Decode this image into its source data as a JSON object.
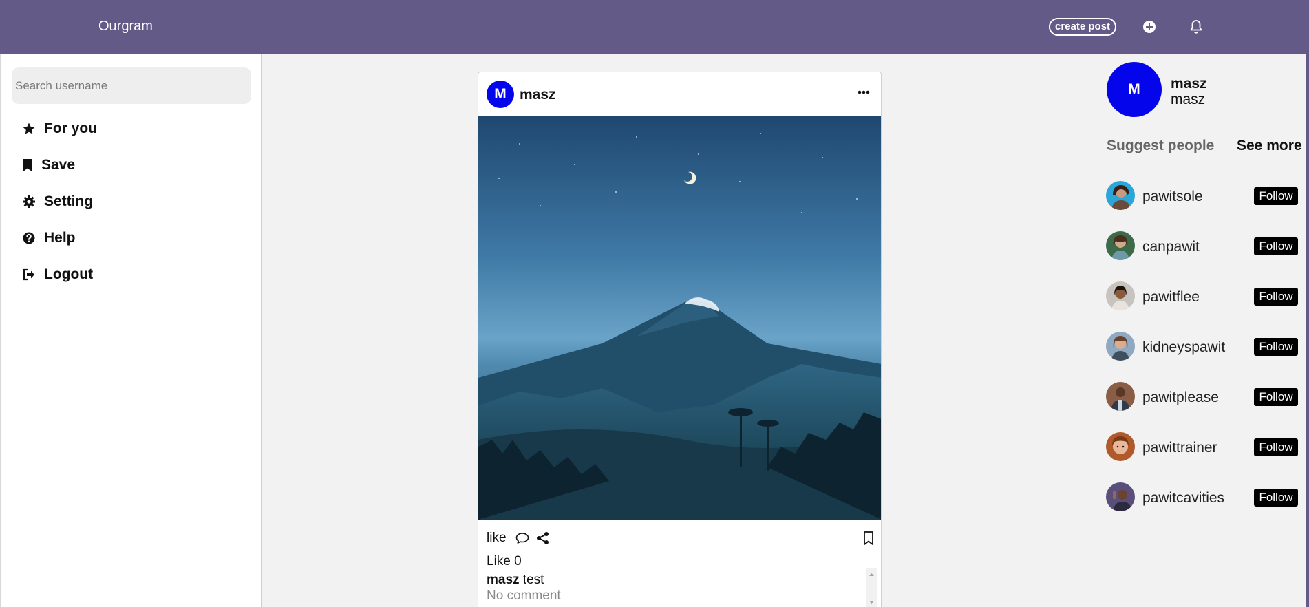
{
  "header": {
    "brand": "Ourgram",
    "create_post_label": "create post",
    "icons": [
      "plus-circle-icon",
      "bell-icon"
    ]
  },
  "colors": {
    "header_bg": "#635a87",
    "avatar_bg": "#0505ec",
    "follow_bg": "#000000"
  },
  "sidebar": {
    "search_placeholder": "Search username",
    "items": [
      {
        "label": "For you",
        "icon": "star-icon"
      },
      {
        "label": "Save",
        "icon": "bookmark-icon"
      },
      {
        "label": "Setting",
        "icon": "gear-icon"
      },
      {
        "label": "Help",
        "icon": "question-circle-icon"
      },
      {
        "label": "Logout",
        "icon": "sign-out-icon"
      }
    ]
  },
  "post": {
    "avatar_letter": "M",
    "username": "masz",
    "actions": {
      "like_label": "like"
    },
    "like_count": "Like 0",
    "caption_user": "masz",
    "caption_text": "test",
    "comments_text": "No comment"
  },
  "profile": {
    "avatar_letter": "M",
    "name": "masz",
    "handle": "masz"
  },
  "suggestions": {
    "title": "Suggest people",
    "see_more": "See more",
    "follow_label": "Follow",
    "people": [
      {
        "name": "pawitsole"
      },
      {
        "name": "canpawit"
      },
      {
        "name": "pawitflee"
      },
      {
        "name": "kidneyspawit"
      },
      {
        "name": "pawitplease"
      },
      {
        "name": "pawittrainer"
      },
      {
        "name": "pawitcavities"
      }
    ]
  }
}
